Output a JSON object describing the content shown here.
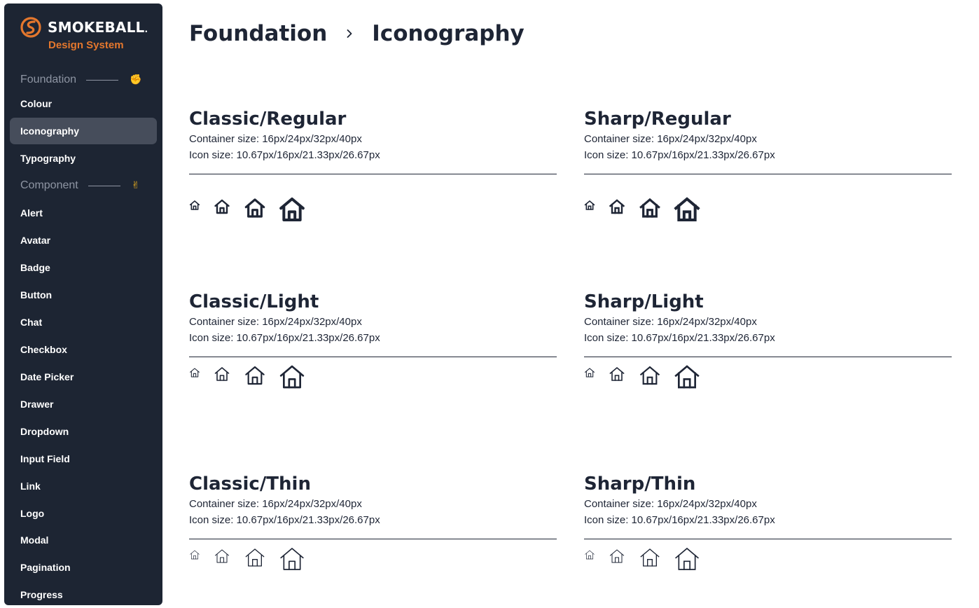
{
  "brand": {
    "name": "SMOKEBALL",
    "trademark": ".",
    "subtitle": "Design System",
    "accent": "#e4772d"
  },
  "sidebar": {
    "bg": "#1d2533",
    "sections": [
      {
        "label": "Foundation",
        "emoji": "✊",
        "items": [
          {
            "label": "Colour",
            "active": false
          },
          {
            "label": "Iconography",
            "active": true
          },
          {
            "label": "Typography",
            "active": false
          }
        ]
      },
      {
        "label": "Component",
        "emoji": "✌",
        "items": [
          {
            "label": "Alert"
          },
          {
            "label": "Avatar"
          },
          {
            "label": "Badge"
          },
          {
            "label": "Button"
          },
          {
            "label": "Chat"
          },
          {
            "label": "Checkbox"
          },
          {
            "label": "Date Picker"
          },
          {
            "label": "Drawer"
          },
          {
            "label": "Dropdown"
          },
          {
            "label": "Input Field"
          },
          {
            "label": "Link"
          },
          {
            "label": "Logo"
          },
          {
            "label": "Modal"
          },
          {
            "label": "Pagination"
          },
          {
            "label": "Progress"
          }
        ]
      }
    ]
  },
  "breadcrumb": {
    "parent": "Foundation",
    "separator_icon": "chevron-right-icon",
    "current": "Iconography"
  },
  "icon_sets": [
    {
      "title": "Classic/Regular",
      "container": "Container size: 16px/24px/32px/40px",
      "icon": "Icon size: 10.67px/16px/21.33px/26.67px",
      "style": "classic",
      "weight": "regular",
      "icon_name": "house-icon"
    },
    {
      "title": "Sharp/Regular",
      "container": "Container size: 16px/24px/32px/40px",
      "icon": "Icon size: 10.67px/16px/21.33px/26.67px",
      "style": "sharp",
      "weight": "regular",
      "icon_name": "house-icon"
    },
    {
      "title": "Classic/Light",
      "container": "Container size: 16px/24px/32px/40px",
      "icon": "Icon size: 10.67px/16px/21.33px/26.67px",
      "style": "classic",
      "weight": "light",
      "icon_name": "house-icon"
    },
    {
      "title": "Sharp/Light",
      "container": "Container size: 16px/24px/32px/40px",
      "icon": "Icon size: 10.67px/16px/21.33px/26.67px",
      "style": "sharp",
      "weight": "light",
      "icon_name": "house-icon"
    },
    {
      "title": "Classic/Thin",
      "container": "Container size: 16px/24px/32px/40px",
      "icon": "Icon size: 10.67px/16px/21.33px/26.67px",
      "style": "classic",
      "weight": "thin",
      "icon_name": "house-icon"
    },
    {
      "title": "Sharp/Thin",
      "container": "Container size: 16px/24px/32px/40px",
      "icon": "Icon size: 10.67px/16px/21.33px/26.67px",
      "style": "sharp",
      "weight": "thin",
      "icon_name": "house-icon"
    }
  ],
  "colors": {
    "text": "#1e2535",
    "active_item_bg": "#464d5b",
    "muted": "#8e95a3"
  }
}
